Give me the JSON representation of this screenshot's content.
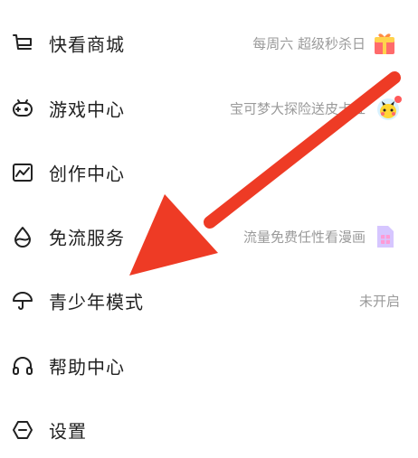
{
  "menu": {
    "items": [
      {
        "label": "快看商城",
        "subtitle": "每周六 超级秒杀日",
        "icon": "shopping-cart-icon",
        "thumb": "gift-box-icon"
      },
      {
        "label": "游戏中心",
        "subtitle": "宝可梦大探险送皮卡丘",
        "icon": "gamepad-icon",
        "thumb": "pikachu-avatar-icon"
      },
      {
        "label": "创作中心",
        "subtitle": "",
        "icon": "chart-frame-icon"
      },
      {
        "label": "免流服务",
        "subtitle": "流量免费任性看漫画",
        "icon": "water-drop-icon",
        "thumb": "sim-card-icon"
      },
      {
        "label": "青少年模式",
        "subtitle": "未开启",
        "icon": "umbrella-icon"
      },
      {
        "label": "帮助中心",
        "subtitle": "",
        "icon": "headphones-icon"
      },
      {
        "label": "设置",
        "subtitle": "",
        "icon": "settings-hexagon-icon"
      }
    ]
  },
  "colors": {
    "arrow": "#ee3b25",
    "text": "#222222",
    "subtext": "#9a9a9a",
    "badge": "#ff5a5a"
  }
}
